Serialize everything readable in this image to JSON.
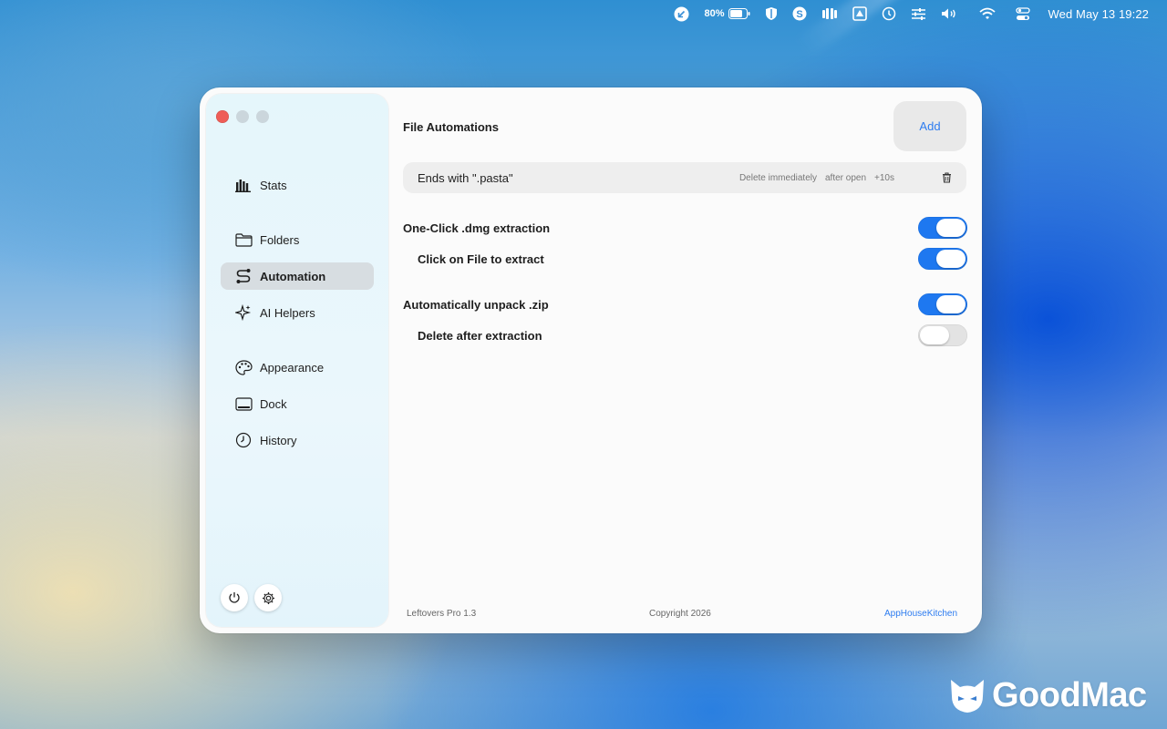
{
  "menubar": {
    "battery_percent": "80%",
    "clock": "Wed May 13  19:22",
    "icons": [
      "download-arrow-icon",
      "battery-icon",
      "shield-icon",
      "s-circle-icon",
      "weight-icon",
      "drive-icon",
      "clock-history-icon",
      "sliders-icon",
      "volume-icon",
      "wifi-icon",
      "control-center-icon"
    ]
  },
  "sidebar": {
    "items": [
      {
        "label": "Stats",
        "icon": "bar-chart-icon"
      },
      {
        "label": "Folders",
        "icon": "folder-icon"
      },
      {
        "label": "Automation",
        "icon": "path-icon",
        "active": true
      },
      {
        "label": "AI Helpers",
        "icon": "sparkle-icon"
      },
      {
        "label": "Appearance",
        "icon": "palette-icon"
      },
      {
        "label": "Dock",
        "icon": "dock-icon"
      },
      {
        "label": "History",
        "icon": "clock-icon"
      }
    ]
  },
  "main": {
    "section_title": "File Automations",
    "add_label": "Add",
    "rule": {
      "name": "Ends with \".pasta\"",
      "action": "Delete immediately",
      "when": "after open",
      "delay": "+10s"
    },
    "settings": [
      {
        "label": "One-Click .dmg extraction",
        "on": true
      },
      {
        "label": "Click on File to extract",
        "on": true
      },
      {
        "label": "Automatically unpack .zip",
        "on": true
      },
      {
        "label": "Delete after extraction",
        "on": false
      }
    ],
    "accent_color": "#1e78f0"
  },
  "footer": {
    "version": "Leftovers Pro 1.3",
    "copyright": "Copyright 2026",
    "company": "AppHouseKitchen"
  },
  "watermark": {
    "text": "GoodMac"
  }
}
